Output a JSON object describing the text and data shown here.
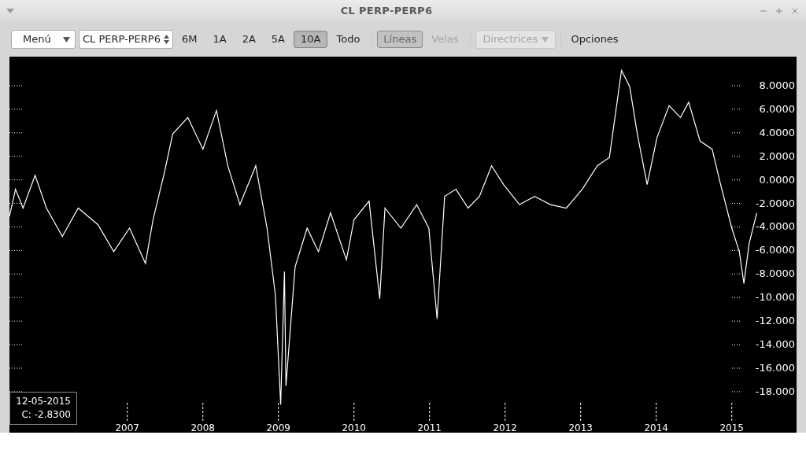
{
  "window": {
    "title": "CL PERP-PERP6"
  },
  "toolbar": {
    "menu_button": {
      "label": "Menú"
    },
    "symbol_select": {
      "value": "CL PERP-PERP6"
    },
    "ranges": [
      {
        "label": "6M",
        "selected": false
      },
      {
        "label": "1A",
        "selected": false
      },
      {
        "label": "2A",
        "selected": false
      },
      {
        "label": "5A",
        "selected": false
      },
      {
        "label": "10A",
        "selected": true
      },
      {
        "label": "Todo",
        "selected": false
      }
    ],
    "chart_types": [
      {
        "label": "Líneas",
        "selected": true,
        "disabled": true
      },
      {
        "label": "Velas",
        "selected": false,
        "disabled": true
      }
    ],
    "guides_dropdown": {
      "label": "Directrices",
      "disabled": true
    },
    "options_button": {
      "label": "Opciones"
    }
  },
  "chart": {
    "tooltip": {
      "date": "12-05-2015",
      "close": "C: -2.8300"
    },
    "chart_data": {
      "type": "line",
      "x": [
        2005.44,
        2005.52,
        2005.62,
        2005.78,
        2005.93,
        2006.14,
        2006.35,
        2006.61,
        2006.82,
        2007.03,
        2007.24,
        2007.34,
        2007.49,
        2007.6,
        2007.8,
        2008.0,
        2008.18,
        2008.33,
        2008.49,
        2008.7,
        2008.85,
        2008.96,
        2009.03,
        2009.08,
        2009.1,
        2009.22,
        2009.38,
        2009.53,
        2009.69,
        2009.9,
        2010.0,
        2010.2,
        2010.34,
        2010.41,
        2010.62,
        2010.83,
        2010.99,
        2011.1,
        2011.2,
        2011.35,
        2011.51,
        2011.66,
        2011.82,
        2011.98,
        2012.19,
        2012.39,
        2012.6,
        2012.81,
        2013.02,
        2013.22,
        2013.38,
        2013.54,
        2013.65,
        2013.75,
        2013.88,
        2014.01,
        2014.17,
        2014.32,
        2014.43,
        2014.58,
        2014.74,
        2014.84,
        2015.0,
        2015.1,
        2015.16,
        2015.23,
        2015.33
      ],
      "xlim": [
        2005.44,
        2015.857
      ],
      "ylim": [
        -21.48,
        10.47
      ],
      "series": [
        {
          "color": "#ffffff",
          "values": [
            -3.1,
            -0.8,
            -2.4,
            0.4,
            -2.4,
            -4.8,
            -2.4,
            -3.8,
            -6.1,
            -4.1,
            -7.1,
            -3.4,
            0.6,
            3.9,
            5.3,
            2.6,
            5.9,
            1.2,
            -2.1,
            1.2,
            -4.1,
            -9.8,
            -19.1,
            -7.8,
            -17.5,
            -7.4,
            -4.1,
            -6.1,
            -2.8,
            -6.8,
            -3.4,
            -1.8,
            -10.1,
            -2.4,
            -4.1,
            -2.1,
            -4.1,
            -11.8,
            -1.4,
            -0.8,
            -2.4,
            -1.4,
            1.2,
            -0.4,
            -2.1,
            -1.4,
            -2.1,
            -2.4,
            -0.8,
            1.2,
            1.9,
            9.3,
            7.9,
            3.9,
            -0.4,
            3.6,
            6.3,
            5.3,
            6.6,
            3.3,
            2.6,
            -0.1,
            -4.1,
            -6.1,
            -8.8,
            -5.4,
            -2.83
          ]
        }
      ],
      "xticks": [
        {
          "value": 2007,
          "label": "2007"
        },
        {
          "value": 2008,
          "label": "2008"
        },
        {
          "value": 2009,
          "label": "2009"
        },
        {
          "value": 2010,
          "label": "2010"
        },
        {
          "value": 2011,
          "label": "2011"
        },
        {
          "value": 2012,
          "label": "2012"
        },
        {
          "value": 2013,
          "label": "2013"
        },
        {
          "value": 2014,
          "label": "2014"
        },
        {
          "value": 2015,
          "label": "2015"
        }
      ],
      "yticks": [
        {
          "value": 8,
          "label": "8.0000"
        },
        {
          "value": 6,
          "label": "6.0000"
        },
        {
          "value": 4,
          "label": "4.0000"
        },
        {
          "value": 2,
          "label": "2.0000"
        },
        {
          "value": 0,
          "label": "0.0000"
        },
        {
          "value": -2,
          "label": "-2.0000"
        },
        {
          "value": -4,
          "label": "-4.0000"
        },
        {
          "value": -6,
          "label": "-6.0000"
        },
        {
          "value": -8,
          "label": "-8.0000"
        },
        {
          "value": -10,
          "label": "-10.000"
        },
        {
          "value": -12,
          "label": "-12.000"
        },
        {
          "value": -14,
          "label": "-14.000"
        },
        {
          "value": -16,
          "label": "-16.000"
        },
        {
          "value": -18,
          "label": "-18.000"
        }
      ]
    }
  }
}
